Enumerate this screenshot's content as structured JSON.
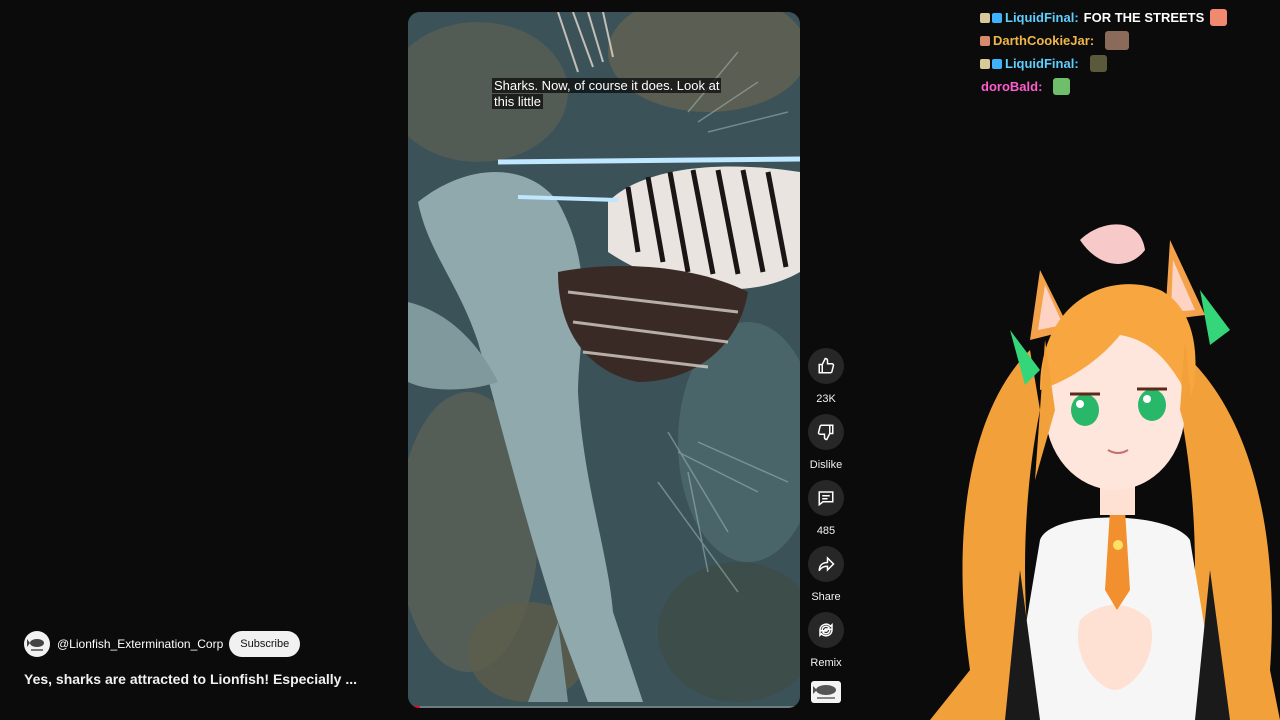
{
  "video": {
    "caption": "Sharks. Now, of course it does. Look at this little",
    "progress_fraction": 0.03
  },
  "actions": {
    "like_count": "23K",
    "dislike_label": "Dislike",
    "comment_count": "485",
    "share_label": "Share",
    "remix_label": "Remix"
  },
  "channel": {
    "handle": "@Lionfish_Extermination_Corp",
    "subscribe_label": "Subscribe"
  },
  "title": "Yes, sharks are attracted to Lionfish! Especially ...",
  "chat": [
    {
      "user": "LiquidFinal",
      "sep": ":",
      "text": "FOR THE STREETS",
      "user_color": "#5ecfff",
      "emote": "cat-emote"
    },
    {
      "user": "DarthCookieJar",
      "sep": ":",
      "text": "",
      "user_color": "#f0b64a",
      "emote": "cookie-emote"
    },
    {
      "user": "LiquidFinal",
      "sep": ":",
      "text": "",
      "user_color": "#5ecfff",
      "emote": "soldier-emote"
    },
    {
      "user": "doroBald",
      "sep": ":",
      "text": "",
      "user_color": "#ff5ccd",
      "emote": "frog-emote"
    }
  ],
  "colors": {
    "accent_red": "#ff0033",
    "button_bg": "#272727"
  }
}
